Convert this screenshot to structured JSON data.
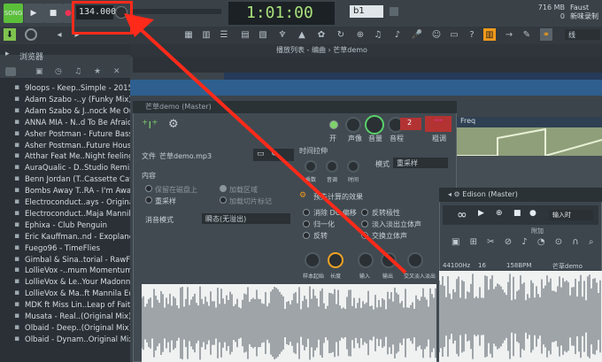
{
  "app": {
    "song_label": "SONG",
    "tempo": "134.000",
    "time": "1:01:00",
    "time_small": "B:S:T",
    "pattern": "b1",
    "memory": "716 MB",
    "memory_num": "0",
    "user": "Faust",
    "user_sub": "新味录制"
  },
  "toolbar": {
    "search_label": "线"
  },
  "browser": {
    "title": "浏览器",
    "items": [
      "9loops - Keep..Simple - 2015",
      "Adam Szabo -..y (Funky Mix)",
      "Adam Szabo & J..nock Me Out",
      "ANNA MIA - N..d To Be Afraid",
      "Asher Postman - Future Bass",
      "Asher Postman..Future House",
      "Atthar Feat Me..Night feeling",
      "AuraQualic - D..Studio Remix)",
      "Benn Jordan (T..Cassette Cafe",
      "Bombs Away T..RA - I'm Awake",
      "Electroconduct..ays - Original",
      "Electroconduct..Maja Mannila)",
      "Ephixa - Club Penguin",
      "Eric Kauffman..nd - Exoplanet",
      "Fuego96 - TimeFlies",
      "Gimbal & Sina..torial - RawFL",
      "LollieVox -..mum Momentum",
      "LollieVox & Le..Your Madonna",
      "LollieVox & Ma..ft Mannila Edit)",
      "MDK ft Miss Lin..Leap of Faith",
      "Musata - Real..(Original Mix)",
      "Olbaid - Deep..(Original Mix)",
      "Olbaid - Dynam..Original Mix)"
    ]
  },
  "playlist": {
    "title": "播放列表 - 编曲 › 芒草demo",
    "freq": "Freq"
  },
  "plugin": {
    "title": "芒草demo (Master)",
    "file_label": "文件",
    "file_name": "芒草demo.mp3",
    "content_label": "内容",
    "keep_label": "保留在磁盘上",
    "resample_label": "重采样",
    "load_region": "加载区域",
    "load_marker": "加载切片标记",
    "declick_label": "消音模式",
    "declick_value": "瞬态(无溢出)",
    "time_label": "时间拉伸",
    "mode_label": "模式",
    "mode_value": "重采样",
    "precompute_title": "预先计算的效果",
    "effects": [
      "消除 DC 偏移",
      "归一化",
      "反转",
      "反转极性",
      "淡入淡出立体声",
      "交换立体声"
    ],
    "knob_labels": [
      "开",
      "声像",
      "音量",
      "音程",
      "",
      "粗调"
    ],
    "knob_value": "2",
    "bottom_knobs": [
      "样本起始",
      "长度",
      "输入",
      "输出",
      "交叉淡入淡出"
    ],
    "time_knobs": [
      "乘数",
      "音调",
      "时间"
    ]
  },
  "edison": {
    "title": "Edison (Master)",
    "input_label": "输入时",
    "attach_label": "附加",
    "freq": "44100Hz",
    "bits": "16",
    "bpm": "158BPM",
    "name": "芒草demo"
  }
}
